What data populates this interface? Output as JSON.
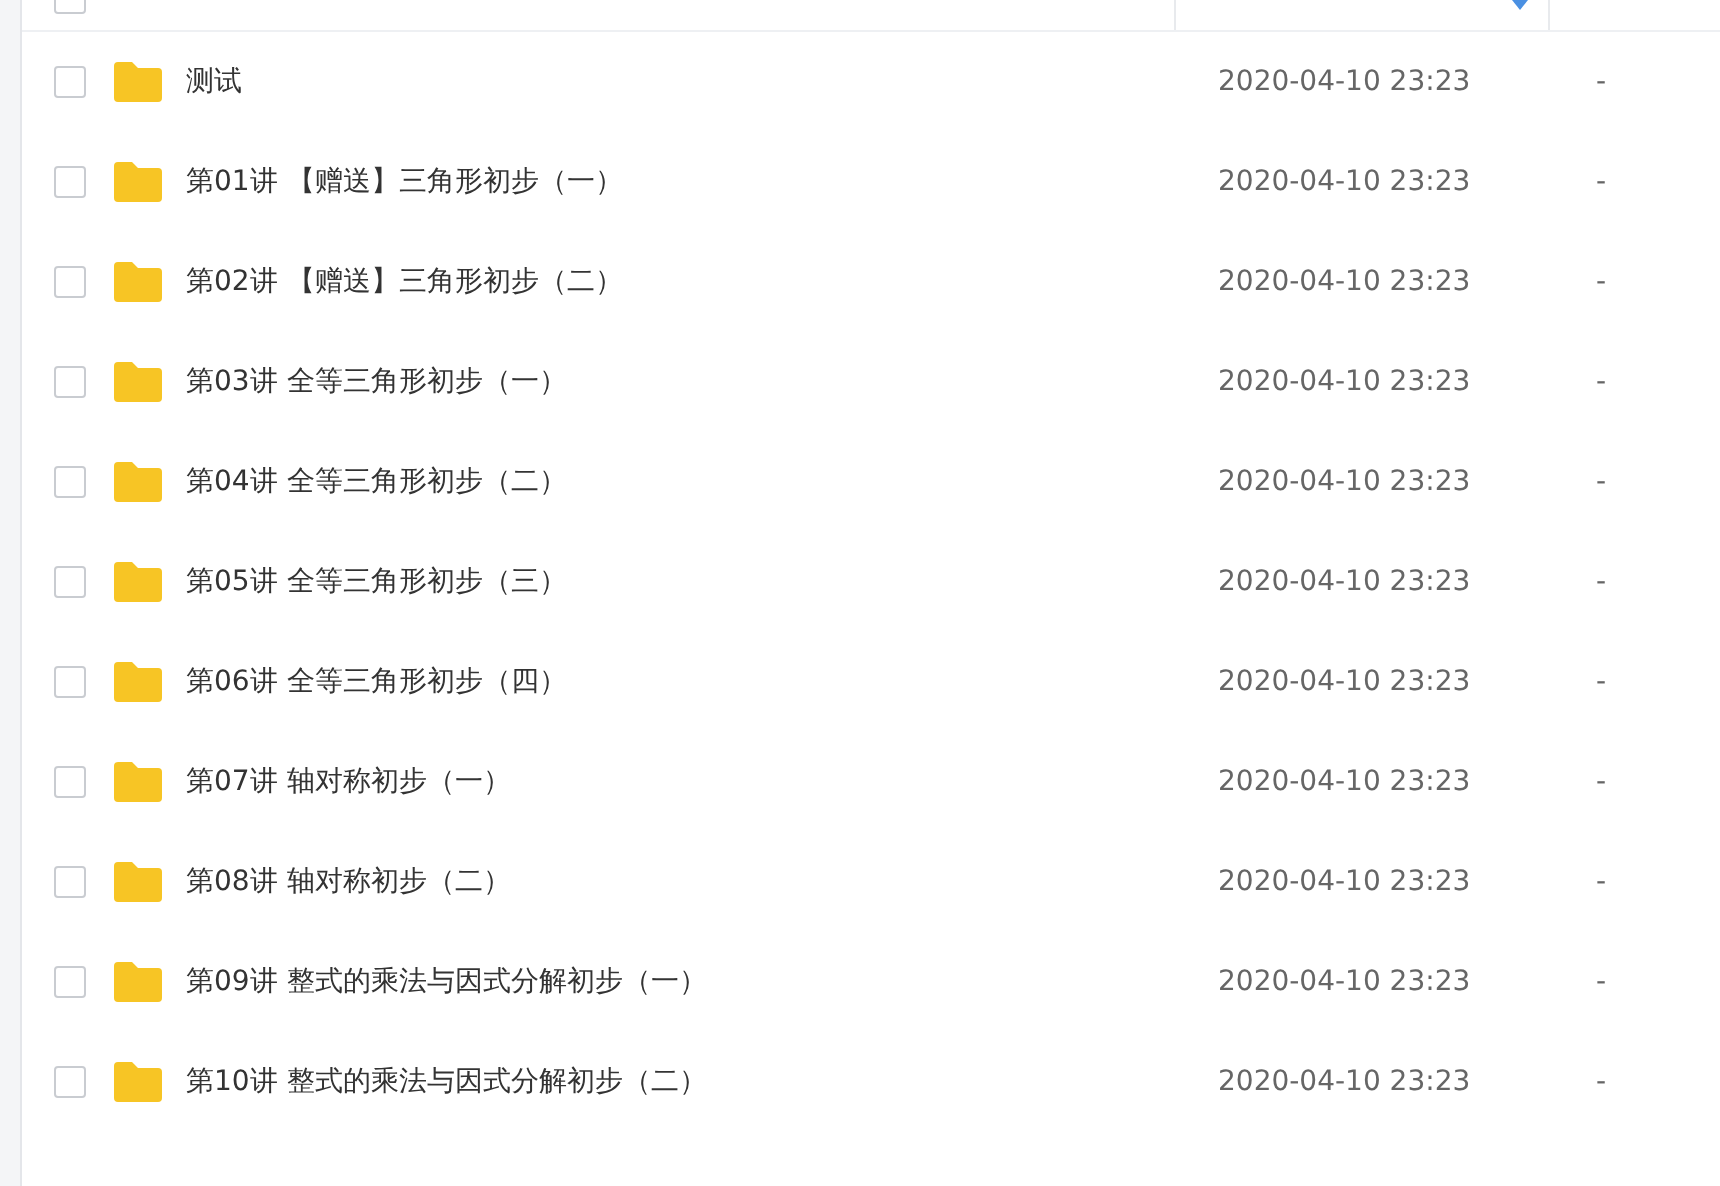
{
  "header": {
    "checked": false
  },
  "rows": [
    {
      "name": "测试",
      "modified": "2020-04-10 23:23",
      "size": "-",
      "checked": false
    },
    {
      "name": "第01讲 【赠送】三角形初步（一）",
      "modified": "2020-04-10 23:23",
      "size": "-",
      "checked": false
    },
    {
      "name": "第02讲 【赠送】三角形初步（二）",
      "modified": "2020-04-10 23:23",
      "size": "-",
      "checked": false
    },
    {
      "name": "第03讲 全等三角形初步（一）",
      "modified": "2020-04-10 23:23",
      "size": "-",
      "checked": false
    },
    {
      "name": "第04讲 全等三角形初步（二）",
      "modified": "2020-04-10 23:23",
      "size": "-",
      "checked": false
    },
    {
      "name": "第05讲 全等三角形初步（三）",
      "modified": "2020-04-10 23:23",
      "size": "-",
      "checked": false
    },
    {
      "name": "第06讲 全等三角形初步（四）",
      "modified": "2020-04-10 23:23",
      "size": "-",
      "checked": false
    },
    {
      "name": "第07讲 轴对称初步（一）",
      "modified": "2020-04-10 23:23",
      "size": "-",
      "checked": false
    },
    {
      "name": "第08讲 轴对称初步（二）",
      "modified": "2020-04-10 23:23",
      "size": "-",
      "checked": false
    },
    {
      "name": "第09讲 整式的乘法与因式分解初步（一）",
      "modified": "2020-04-10 23:23",
      "size": "-",
      "checked": false
    },
    {
      "name": "第10讲 整式的乘法与因式分解初步（二）",
      "modified": "2020-04-10 23:23",
      "size": "-",
      "checked": false
    }
  ]
}
